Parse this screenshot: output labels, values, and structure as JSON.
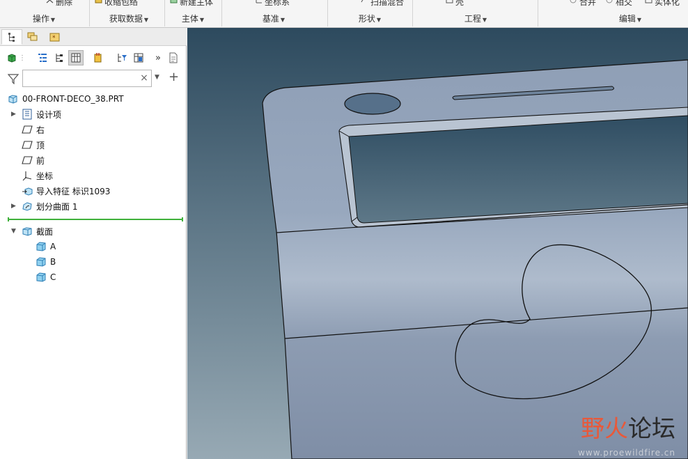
{
  "ribbon": {
    "cut_labels": [
      "删除",
      "收缩包络",
      "新建主体",
      "坐标系",
      "扫描混合",
      "壳",
      "合并",
      "相交",
      "实体化"
    ],
    "groups": [
      {
        "label": "操作"
      },
      {
        "label": "获取数据"
      },
      {
        "label": "主体"
      },
      {
        "label": "基准"
      },
      {
        "label": "形状"
      },
      {
        "label": "工程"
      },
      {
        "label": "编辑"
      }
    ]
  },
  "left_panel": {
    "tabs": [
      {
        "icon": "model-tree-icon",
        "active": true
      },
      {
        "icon": "layer-tree-icon",
        "active": false
      },
      {
        "icon": "favorites-icon",
        "active": false
      }
    ],
    "search": {
      "value": "",
      "placeholder": ""
    },
    "insert_line_color": "#3fb03a"
  },
  "tree": {
    "root": {
      "label": "00-FRONT-DECO_38.PRT",
      "icon": "part-icon"
    },
    "items": [
      {
        "label": "设计项",
        "icon": "design-items-icon",
        "expandable": true
      },
      {
        "label": "右",
        "icon": "datum-plane-icon",
        "expandable": false
      },
      {
        "label": "顶",
        "icon": "datum-plane-icon",
        "expandable": false
      },
      {
        "label": "前",
        "icon": "datum-plane-icon",
        "expandable": false
      },
      {
        "label": "坐标",
        "icon": "coordinate-system-icon",
        "expandable": false
      },
      {
        "label": "导入特征 标识1093",
        "icon": "import-feature-icon",
        "expandable": false
      },
      {
        "label": "划分曲面 1",
        "icon": "split-surface-icon",
        "expandable": true
      }
    ],
    "sections": {
      "label": "截面",
      "icon": "section-icon",
      "children": [
        {
          "label": "A"
        },
        {
          "label": "B"
        },
        {
          "label": "C"
        }
      ]
    }
  },
  "viewport": {
    "background_top": "#2d4a5e",
    "background_bottom": "#97a9b4",
    "watermark": {
      "part1": "野火",
      "part2": "论坛",
      "url": "www.proewildfire.cn"
    }
  }
}
